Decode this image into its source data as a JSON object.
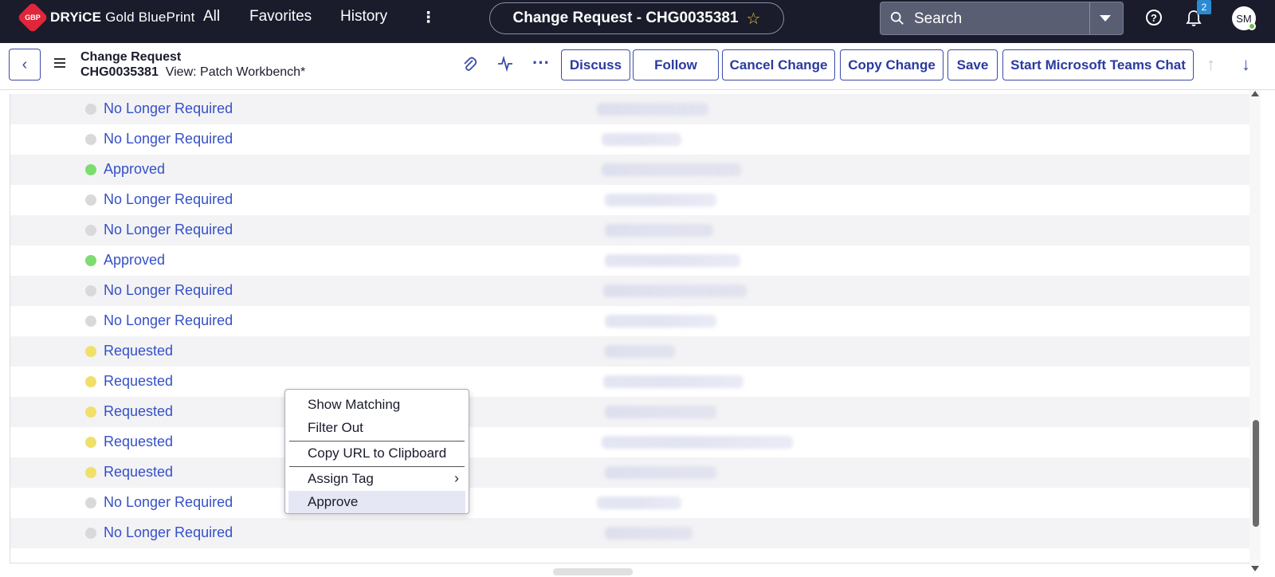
{
  "topnav": {
    "logo_text_bold": "DRYiCE",
    "logo_text_rest": " Gold BluePrint",
    "logo_badge": "GBP",
    "links": [
      "All",
      "Favorites",
      "History"
    ],
    "record_title": "Change Request - CHG0035381",
    "search_label": "Search",
    "notification_count": "2",
    "avatar_initials": "SM",
    "icons": {
      "more": "more-vertical-icon",
      "star": "star-icon",
      "search": "search-icon",
      "help": "help-icon",
      "bell": "bell-icon"
    }
  },
  "header": {
    "table_label": "Change Request",
    "number": "CHG0035381",
    "view_label": "View: Patch Workbench*",
    "buttons": [
      "Discuss",
      "Follow",
      "Cancel Change",
      "Copy Change",
      "Save",
      "Start Microsoft Teams Chat"
    ]
  },
  "rows": [
    {
      "state": "No Longer Required",
      "color": "#d9d9d9"
    },
    {
      "state": "No Longer Required",
      "color": "#d9d9d9"
    },
    {
      "state": "Approved",
      "color": "#7ddc6f"
    },
    {
      "state": "No Longer Required",
      "color": "#d9d9d9"
    },
    {
      "state": "No Longer Required",
      "color": "#d9d9d9"
    },
    {
      "state": "Approved",
      "color": "#7ddc6f"
    },
    {
      "state": "No Longer Required",
      "color": "#d9d9d9"
    },
    {
      "state": "No Longer Required",
      "color": "#d9d9d9"
    },
    {
      "state": "Requested",
      "color": "#f0e06a"
    },
    {
      "state": "Requested",
      "color": "#f0e06a"
    },
    {
      "state": "Requested",
      "color": "#f0e06a"
    },
    {
      "state": "Requested",
      "color": "#f0e06a"
    },
    {
      "state": "Requested",
      "color": "#f0e06a"
    },
    {
      "state": "No Longer Required",
      "color": "#d9d9d9"
    },
    {
      "state": "No Longer Required",
      "color": "#d9d9d9"
    }
  ],
  "context_menu": {
    "items": [
      "Show Matching",
      "Filter Out",
      "Copy URL to Clipboard",
      "Assign Tag",
      "Approve"
    ]
  }
}
